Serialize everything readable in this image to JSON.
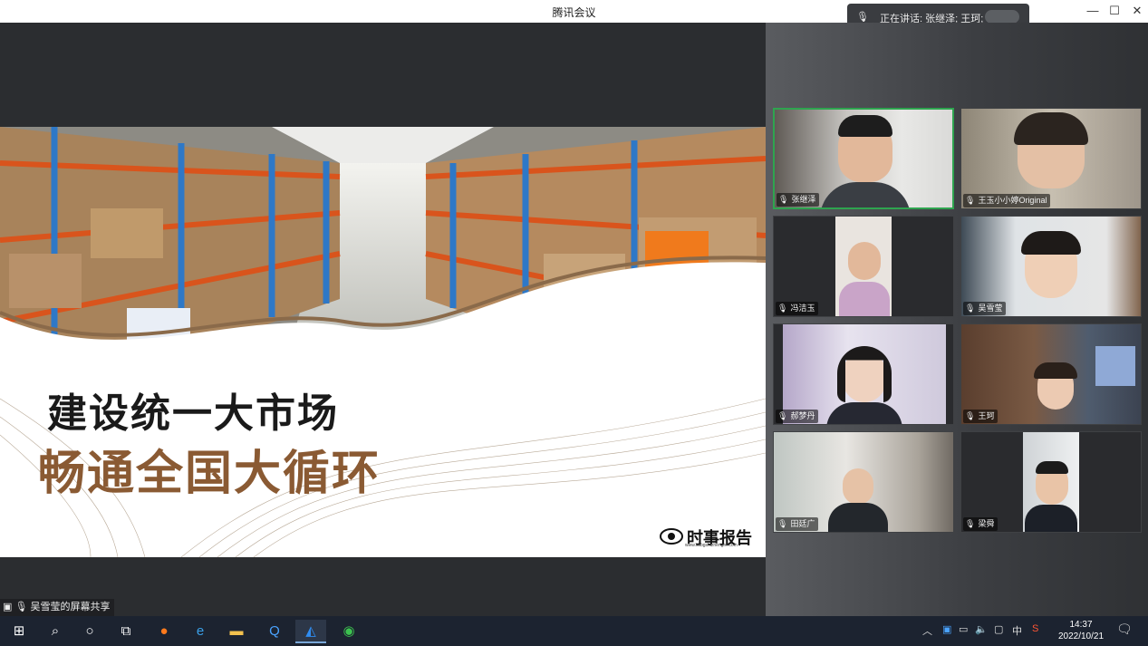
{
  "window": {
    "title": "腾讯会议"
  },
  "speaking": {
    "text": "正在讲话: 张继泽; 王珂;"
  },
  "slide": {
    "line1": "建设统一大市场",
    "line2": "畅通全国大循环",
    "logo_text": "时事报告",
    "logo_url": "www.ssbgshizhengre.com"
  },
  "participants": [
    {
      "name": "张继泽"
    },
    {
      "name": "王玉小小婷Original"
    },
    {
      "name": "冯洁玉"
    },
    {
      "name": "吴雪莹"
    },
    {
      "name": "郝梦丹"
    },
    {
      "name": "王珂"
    },
    {
      "name": "田廷广"
    },
    {
      "name": "梁舜"
    }
  ],
  "share_tag": "吴雪莹的屏幕共享",
  "clock": {
    "time": "14:37",
    "date": "2022/10/21"
  },
  "tray": {
    "ime": "中"
  },
  "colors": {
    "active_border": "#2ea44f",
    "slide_brown": "#8a5a33",
    "taskbar": "#1c2330"
  }
}
